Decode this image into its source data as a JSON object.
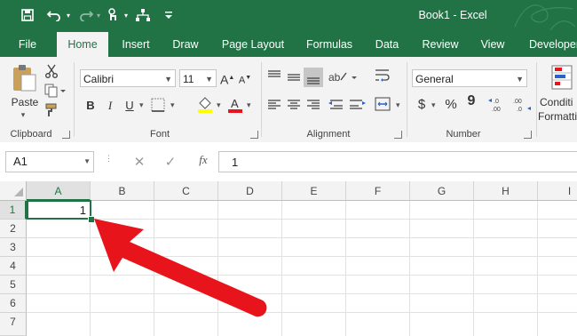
{
  "window": {
    "title": "Book1  -  Excel"
  },
  "tabs": [
    "File",
    "Home",
    "Insert",
    "Draw",
    "Page Layout",
    "Formulas",
    "Data",
    "Review",
    "View",
    "Developer"
  ],
  "ribbon": {
    "clipboard": {
      "label": "Clipboard",
      "paste_label": "Paste"
    },
    "font": {
      "label": "Font",
      "font_name": "Calibri",
      "font_size": "11",
      "bold": "B",
      "italic": "I",
      "underline": "U",
      "grow": "A",
      "shrink": "A"
    },
    "alignment": {
      "label": "Alignment"
    },
    "number": {
      "label": "Number",
      "format": "General",
      "currency": "$",
      "percent": "%",
      "comma": "9"
    },
    "styles": {
      "conditional_line1": "Conditi",
      "conditional_line2": "Formatti"
    }
  },
  "formula_bar": {
    "name_box": "A1",
    "fx": "fx",
    "value": "1"
  },
  "grid": {
    "columns": [
      "A",
      "B",
      "C",
      "D",
      "E",
      "F",
      "G",
      "H",
      "I"
    ],
    "rows": [
      "1",
      "2",
      "3",
      "4",
      "5",
      "6",
      "7"
    ],
    "selected_cell": "A1",
    "cell_a1": "1"
  },
  "colors": {
    "excel_green": "#217346",
    "arrow_red": "#e8141b"
  }
}
